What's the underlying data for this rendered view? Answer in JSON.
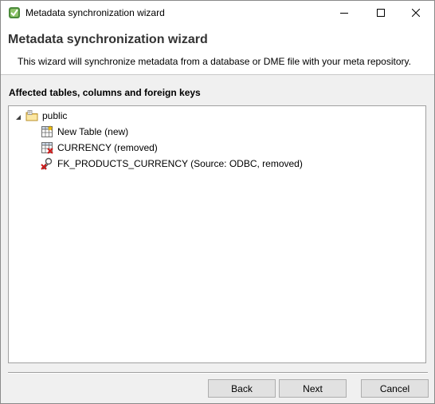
{
  "window": {
    "title": "Metadata synchronization wizard",
    "controls": [
      "minimize-icon",
      "maximize-icon",
      "close-icon"
    ]
  },
  "header": {
    "title": "Metadata synchronization wizard",
    "description": "This wizard will synchronize metadata from a database or DME file with your meta repository."
  },
  "section": {
    "label": "Affected tables, columns and foreign keys"
  },
  "tree": {
    "root": {
      "label": "public",
      "icon": "schema-folder-icon",
      "expanded": true
    },
    "items": [
      {
        "label": "New Table (new)",
        "icon": "table-new-icon"
      },
      {
        "label": "CURRENCY (removed)",
        "icon": "table-removed-icon"
      },
      {
        "label": "FK_PRODUCTS_CURRENCY (Source: ODBC, removed)",
        "icon": "foreign-key-removed-icon"
      }
    ]
  },
  "buttons": {
    "back": "Back",
    "next": "Next",
    "cancel": "Cancel"
  }
}
